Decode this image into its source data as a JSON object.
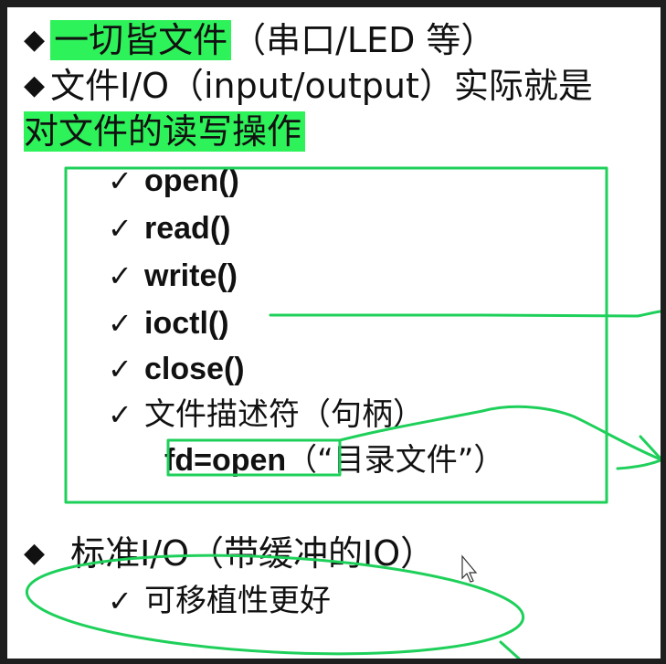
{
  "bullets": {
    "b1_highlight": "一切皆文件",
    "b1_rest": "（串口/LED 等）",
    "b2_line1": "文件I/O（input/output）实际就是",
    "b2_line2": "对文件的读写操作"
  },
  "functions": [
    {
      "name": "open()"
    },
    {
      "name": "read()"
    },
    {
      "name": "write()"
    },
    {
      "name": "ioctl()"
    },
    {
      "name": "close()"
    }
  ],
  "descriptor": {
    "label": "文件描述符（句柄）",
    "fd": "fd=open",
    "arg": "（“目录文件”）"
  },
  "standard_io": {
    "title": "标准I/O（带缓冲的IO）",
    "item": "可移植性更好"
  },
  "glyphs": {
    "bullet": "◆",
    "check": "✓"
  },
  "colors": {
    "highlight": "#2ef25a",
    "annotation": "#1ed05a",
    "background": "#ffffff",
    "frame": "#1e1e1e"
  }
}
